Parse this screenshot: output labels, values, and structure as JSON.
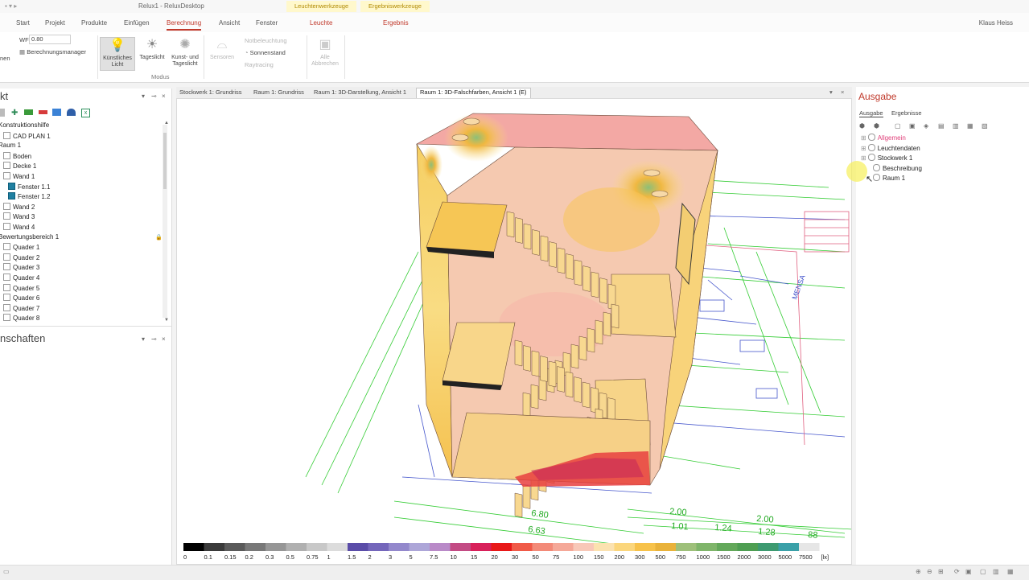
{
  "window": {
    "title": "Relux1 - ReluxDesktop",
    "context_labels": [
      "Leuchtenwerkzeuge",
      "Ergebniswerkzeuge"
    ],
    "user": "Klaus Heiss"
  },
  "menu": {
    "tabs": [
      "Start",
      "Projekt",
      "Produkte",
      "Einfügen",
      "Berechnung",
      "Ansicht",
      "Fenster"
    ],
    "active": "Berechnung",
    "context_tabs": [
      "Leuchte",
      "Ergebnis"
    ]
  },
  "ribbon": {
    "partial_left": "nen",
    "wf_label": "WF",
    "wf_value": "0.80",
    "calc_manager": "Berechnungsmanager",
    "artificial_light": "Künstliches Licht",
    "daylight": "Tageslicht",
    "artificial_and_daylight": "Kunst- und Tageslicht",
    "group_label": "Modus",
    "emergency": "Notbeleuchtung",
    "sun_position": "Sonnenstand",
    "raytracing": "Raytracing",
    "sensors": "Sensoren",
    "abort_all": "Alle Abbrechen"
  },
  "left_panel": {
    "title": "kt",
    "properties_title": "nschaften",
    "tree": [
      {
        "label": "Konstruktionshilfe",
        "indent": 0
      },
      {
        "label": "CAD PLAN 1",
        "indent": 1
      },
      {
        "label": "Raum 1",
        "indent": 0
      },
      {
        "label": "Boden",
        "indent": 1
      },
      {
        "label": "Decke 1",
        "indent": 1
      },
      {
        "label": "Wand 1",
        "indent": 1
      },
      {
        "label": "Fenster 1.1",
        "indent": 2,
        "window": true
      },
      {
        "label": "Fenster 1.2",
        "indent": 2,
        "window": true
      },
      {
        "label": "Wand 2",
        "indent": 1
      },
      {
        "label": "Wand 3",
        "indent": 1
      },
      {
        "label": "Wand 4",
        "indent": 1
      },
      {
        "label": "Bewertungsbereich 1",
        "indent": 0
      },
      {
        "label": "Quader 1",
        "indent": 1
      },
      {
        "label": "Quader 2",
        "indent": 1
      },
      {
        "label": "Quader 3",
        "indent": 1
      },
      {
        "label": "Quader 4",
        "indent": 1
      },
      {
        "label": "Quader 5",
        "indent": 1
      },
      {
        "label": "Quader 6",
        "indent": 1
      },
      {
        "label": "Quader 7",
        "indent": 1
      },
      {
        "label": "Quader 8",
        "indent": 1
      }
    ]
  },
  "doc_tabs": [
    "Stockwerk 1: Grundriss",
    "Raum 1: Grundriss",
    "Raum 1: 3D-Darstellung, Ansicht 1",
    "Raum 1: 3D-Falschfarben, Ansicht 1 (E)"
  ],
  "doc_tab_active": 3,
  "viewport": {
    "plan_text": "MENSA",
    "dims": [
      "6.80",
      "6.63",
      "2.00",
      "1.01",
      "1.24",
      "2.00",
      "1.28",
      "88"
    ],
    "legend_unit": "[lx]",
    "legend": [
      {
        "v": "0",
        "c": "#000000"
      },
      {
        "v": "0.1",
        "c": "#3a3a3a"
      },
      {
        "v": "0.15",
        "c": "#5a5a5a"
      },
      {
        "v": "0.2",
        "c": "#787878"
      },
      {
        "v": "0.3",
        "c": "#969696"
      },
      {
        "v": "0.5",
        "c": "#b0b0b0"
      },
      {
        "v": "0.75",
        "c": "#c8c8c8"
      },
      {
        "v": "1",
        "c": "#dcdcdc"
      },
      {
        "v": "1.5",
        "c": "#5a4ca8"
      },
      {
        "v": "2",
        "c": "#7466bb"
      },
      {
        "v": "3",
        "c": "#9388cc"
      },
      {
        "v": "5",
        "c": "#ada6d8"
      },
      {
        "v": "7.5",
        "c": "#b98ac8"
      },
      {
        "v": "10",
        "c": "#c34b84"
      },
      {
        "v": "15",
        "c": "#d8205a"
      },
      {
        "v": "20",
        "c": "#e81818"
      },
      {
        "v": "30",
        "c": "#f05a48"
      },
      {
        "v": "50",
        "c": "#f38a78"
      },
      {
        "v": "75",
        "c": "#f5a898"
      },
      {
        "v": "100",
        "c": "#f8c8b8"
      },
      {
        "v": "150",
        "c": "#fbe2b0"
      },
      {
        "v": "200",
        "c": "#fbd67c"
      },
      {
        "v": "300",
        "c": "#f7c24a"
      },
      {
        "v": "500",
        "c": "#e9b23a"
      },
      {
        "v": "750",
        "c": "#9ec07a"
      },
      {
        "v": "1000",
        "c": "#7fb56a"
      },
      {
        "v": "1500",
        "c": "#63a85a"
      },
      {
        "v": "2000",
        "c": "#4e9e52"
      },
      {
        "v": "3000",
        "c": "#3d9a70"
      },
      {
        "v": "5000",
        "c": "#3aa0a8"
      },
      {
        "v": "7500",
        "c": "#e6e6e6"
      }
    ]
  },
  "right_panel": {
    "title": "Ausgabe",
    "tabs": [
      "Ausgabe",
      "Ergebnisse"
    ],
    "tree": [
      {
        "label": "Allgemein",
        "indent": 0,
        "highlight": true
      },
      {
        "label": "Leuchtendaten",
        "indent": 0
      },
      {
        "label": "Stockwerk 1",
        "indent": 0
      },
      {
        "label": "Beschreibung",
        "indent": 1
      },
      {
        "label": "Raum 1",
        "indent": 1
      }
    ]
  }
}
